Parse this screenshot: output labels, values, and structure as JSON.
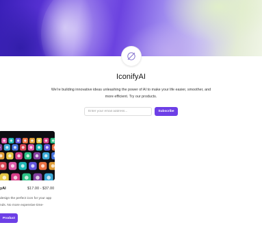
{
  "header": {
    "brand_name": "IconifyAI",
    "tagline": "We're building innovative ideas unleashing the power of AI to make your life easier, smoother, and more efficient. Try our products.",
    "logo_icon": "slashed-circle-logo-icon"
  },
  "subscribe": {
    "email_placeholder": "Enter your email address...",
    "button_label": "Subscribe"
  },
  "products": [
    {
      "name": "yAI",
      "price": "$17.00 - $37.00",
      "description": "design the perfect icon for your app nds. No more expensive time-",
      "button_label": "Product",
      "image": "app-icons-grid-image"
    }
  ],
  "colors": {
    "accent": "#6d3fe6",
    "banner_start": "#3a1fb8",
    "banner_end": "#f0f5e6"
  }
}
